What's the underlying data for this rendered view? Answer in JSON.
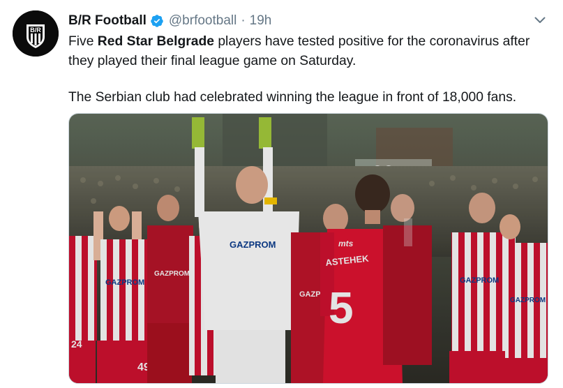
{
  "tweet": {
    "author_name": "B/R Football",
    "handle": "@brfootball",
    "separator": "·",
    "time": "19h",
    "text_part1": "Five ",
    "text_bold": "Red Star Belgrade",
    "text_part2": " players have tested positive for the coronavirus after they played their final league game on Saturday.",
    "text_second": "The Serbian club had celebrated winning the league in front of 18,000 fans.",
    "avatar_label": "B/R",
    "verified_icon": "verified-badge-icon",
    "caret_icon": "chevron-down-icon"
  },
  "photo": {
    "sponsor_text": "GAZPROM",
    "jersey_name": "ASTEHEK",
    "jersey_number": "5",
    "shorts_number": "49",
    "side_number": "24",
    "jersey_brand": "mts",
    "colors": {
      "red": "#c8102e",
      "white": "#f2f2f2",
      "crowd": "#3a3a32"
    }
  },
  "colors": {
    "text": "#14171a",
    "muted": "#657786",
    "verified": "#1da1f2",
    "border": "#ccd6dd"
  }
}
